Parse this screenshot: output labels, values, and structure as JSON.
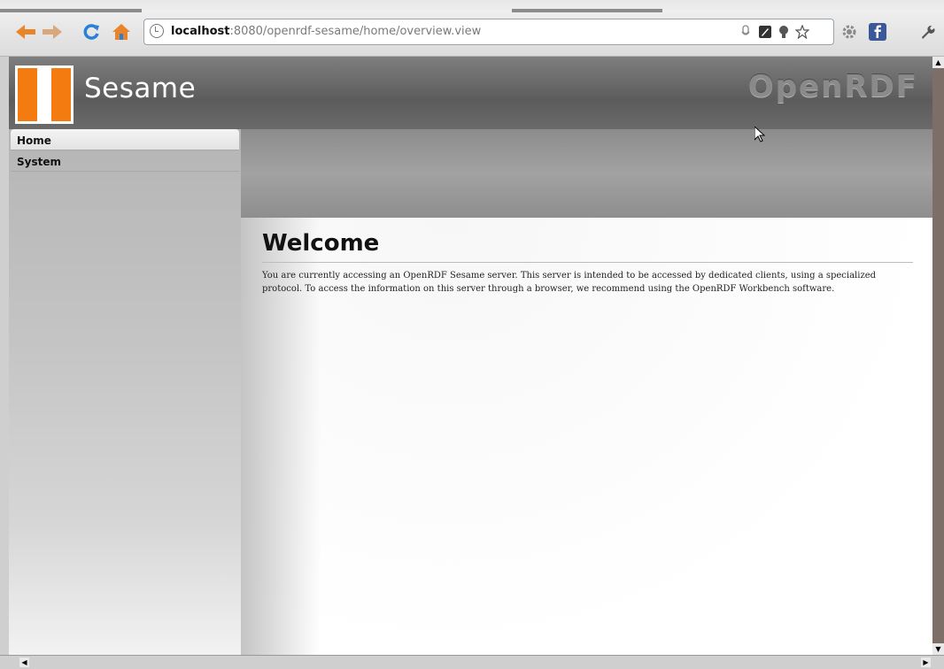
{
  "browser": {
    "url_host": "localhost",
    "url_path": ":8080/openrdf-sesame/home/overview.view",
    "icons": [
      "back-icon",
      "forward-icon",
      "reload-icon",
      "home-icon",
      "page-info-icon",
      "mic-icon",
      "bookmark-ext-icon",
      "lightbulb-icon",
      "star-icon",
      "settings-gear-icon",
      "facebook-icon",
      "wrench-icon"
    ],
    "colors": {
      "back": "#e8852a",
      "reload": "#2b7fd8",
      "home": "#e8852a",
      "facebook": "#3b5998"
    }
  },
  "header": {
    "logo_text": "Sesame",
    "brand": "OpenRDF",
    "logo_color": "#f47b10"
  },
  "sidebar": {
    "items": [
      {
        "label": "Home",
        "active": true
      },
      {
        "label": "System",
        "active": false
      }
    ]
  },
  "main": {
    "title": "Welcome",
    "body": "You are currently accessing an OpenRDF Sesame server. This server is intended to be accessed by dedicated clients, using a specialized protocol. To access the information on this server through a browser, we recommend using the OpenRDF Workbench software."
  }
}
